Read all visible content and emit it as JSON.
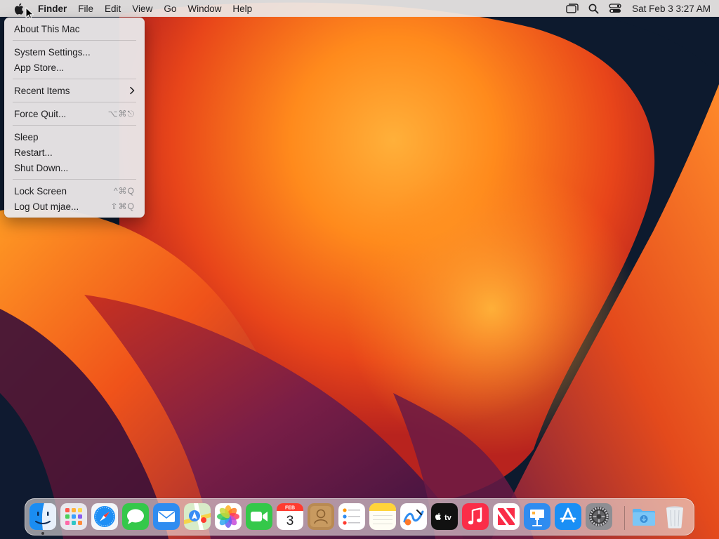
{
  "menubar": {
    "app_name": "Finder",
    "menus": [
      "File",
      "Edit",
      "View",
      "Go",
      "Window",
      "Help"
    ],
    "clock": "Sat Feb 3  3:27 AM"
  },
  "apple_menu": {
    "items": [
      {
        "label": "About This Mac",
        "shortcut": ""
      },
      {
        "label": "System Settings...",
        "shortcut": ""
      },
      {
        "label": "App Store...",
        "shortcut": ""
      },
      {
        "label": "Recent Items",
        "shortcut": ""
      },
      {
        "label": "Force Quit...",
        "shortcut": "⌥⌘⎋"
      },
      {
        "label": "Sleep",
        "shortcut": ""
      },
      {
        "label": "Restart...",
        "shortcut": ""
      },
      {
        "label": "Shut Down...",
        "shortcut": ""
      },
      {
        "label": "Lock Screen",
        "shortcut": "^⌘Q"
      },
      {
        "label": "Log Out mjae...",
        "shortcut": "⇧⌘Q"
      }
    ]
  },
  "dock": {
    "calendar_month": "FEB",
    "calendar_day": "3",
    "tv_label": "tv",
    "apps": [
      "finder",
      "launchpad",
      "safari",
      "messages",
      "mail",
      "maps",
      "photos",
      "facetime",
      "calendar",
      "contacts",
      "reminders",
      "notes",
      "freeform",
      "tv",
      "music",
      "news",
      "keynote",
      "app-store",
      "system-settings",
      "downloads",
      "trash"
    ]
  },
  "colors": {
    "menubar_bg": "#ece8e6",
    "wallpaper_orange": "#ff7a1a",
    "wallpaper_red": "#d9261c",
    "wallpaper_purple": "#5a1a4a",
    "wallpaper_navy": "#0d1a2e"
  }
}
